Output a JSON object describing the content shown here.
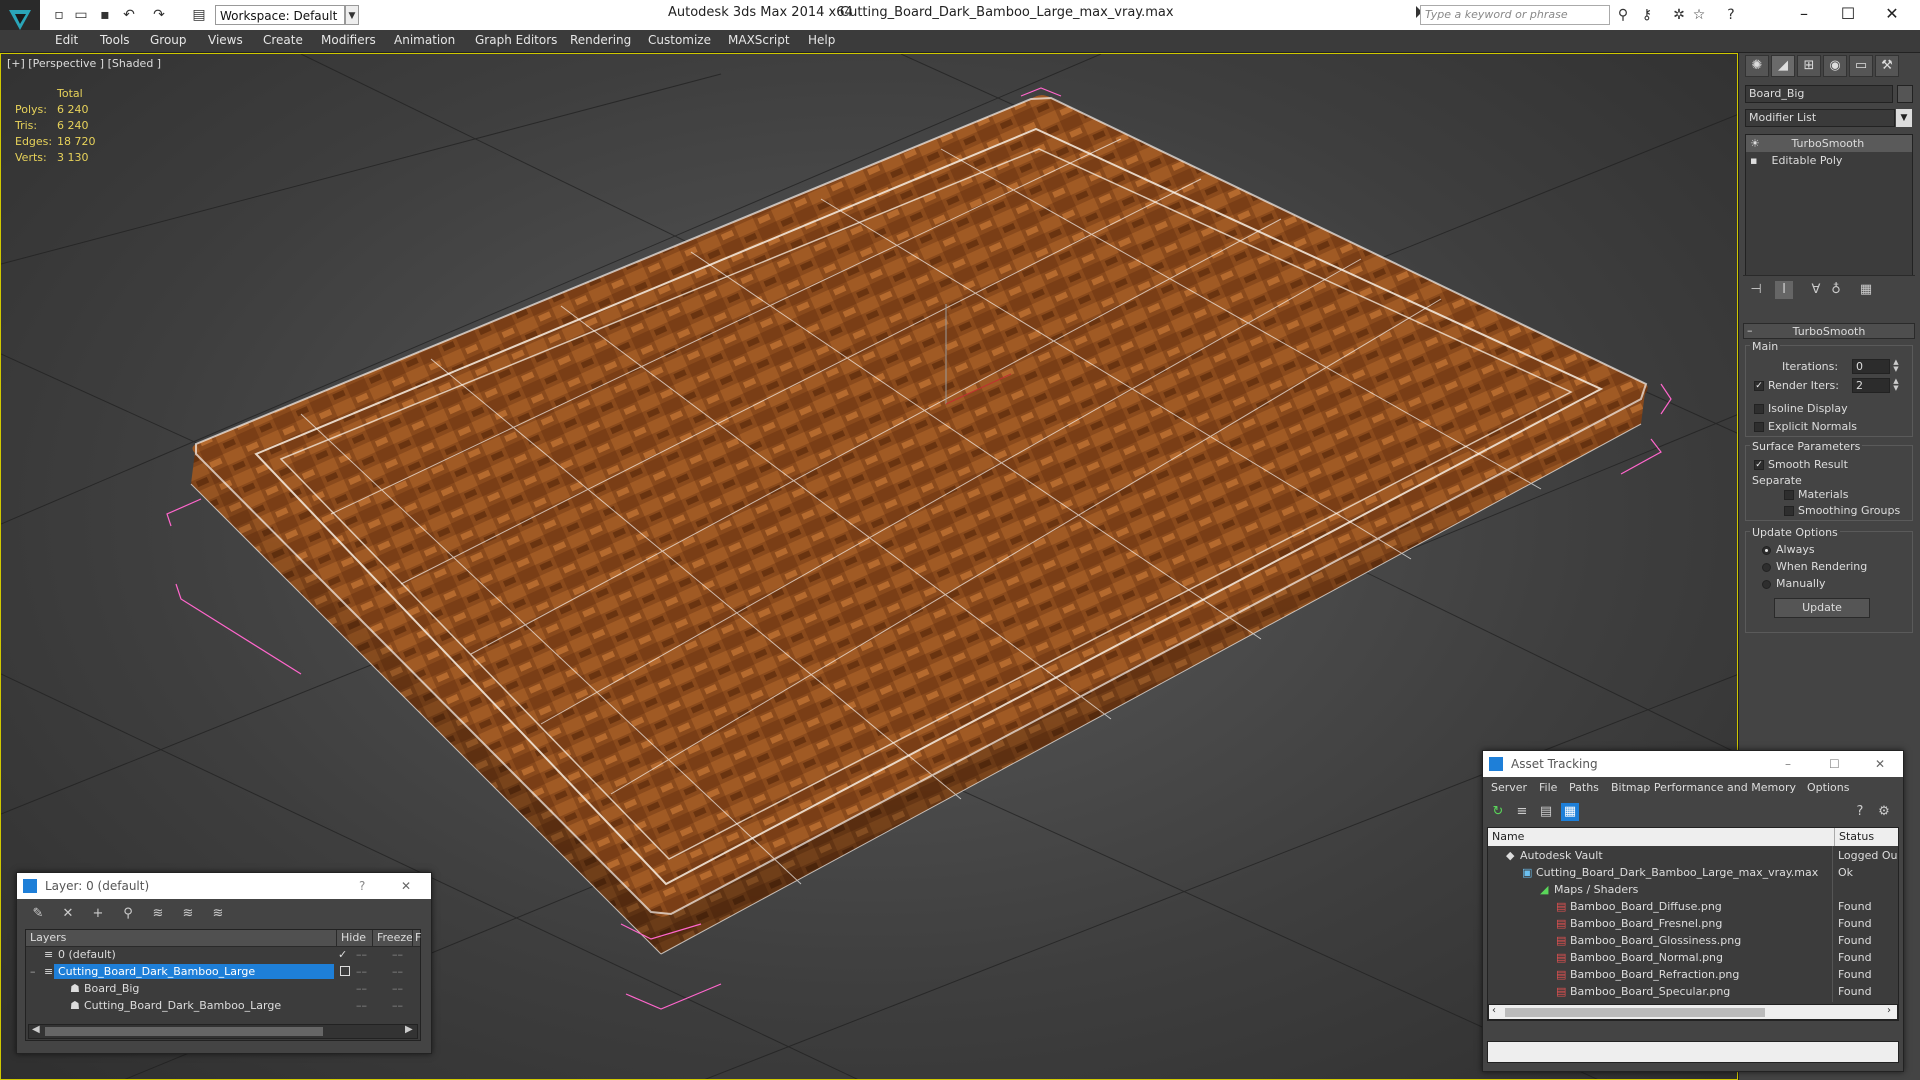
{
  "titlebar": {
    "app_title": "Autodesk 3ds Max  2014 x64",
    "file_title": "Cutting_Board_Dark_Bamboo_Large_max_vray.max",
    "workspace": "Workspace: Default",
    "search_placeholder": "Type a keyword or phrase"
  },
  "menu": [
    "Edit",
    "Tools",
    "Group",
    "Views",
    "Create",
    "Modifiers",
    "Animation",
    "Graph Editors",
    "Rendering",
    "Customize",
    "MAXScript",
    "Help"
  ],
  "viewport": {
    "label": "[+] [Perspective ] [Shaded ]",
    "stats": {
      "header": "Total",
      "rows": [
        {
          "k": "Polys:",
          "v": "6 240"
        },
        {
          "k": "Tris:",
          "v": "6 240"
        },
        {
          "k": "Edges:",
          "v": "18 720"
        },
        {
          "k": "Verts:",
          "v": "3 130"
        }
      ]
    }
  },
  "command_panel": {
    "object_name": "Board_Big",
    "modifier_list": "Modifier List",
    "stack": [
      "TurboSmooth",
      "Editable Poly"
    ],
    "rollout": "TurboSmooth",
    "main_group": "Main",
    "iterations_label": "Iterations:",
    "iterations_value": "0",
    "render_iters_label": "Render Iters:",
    "render_iters_value": "2",
    "isoline": "Isoline Display",
    "explicit_normals": "Explicit Normals",
    "surface_group": "Surface Parameters",
    "smooth_result": "Smooth Result",
    "separate": "Separate",
    "materials": "Materials",
    "smoothing_groups": "Smoothing Groups",
    "update_group": "Update Options",
    "always": "Always",
    "when_rendering": "When Rendering",
    "manually": "Manually",
    "update_btn": "Update"
  },
  "layer_window": {
    "title": "Layer: 0 (default)",
    "help": "?",
    "columns": [
      "Layers",
      "Hide",
      "Freeze",
      "F"
    ],
    "rows": [
      {
        "name": "0 (default)"
      },
      {
        "name": "Cutting_Board_Dark_Bamboo_Large"
      },
      {
        "name": "Board_Big"
      },
      {
        "name": "Cutting_Board_Dark_Bamboo_Large"
      }
    ]
  },
  "asset_window": {
    "title": "Asset Tracking",
    "menu": [
      "Server",
      "File",
      "Paths",
      "Bitmap Performance and Memory",
      "Options"
    ],
    "columns": [
      "Name",
      "Status"
    ],
    "rows": [
      {
        "name": "Autodesk Vault",
        "status": "Logged Ou"
      },
      {
        "name": "Cutting_Board_Dark_Bamboo_Large_max_vray.max",
        "status": "Ok"
      },
      {
        "name": "Maps / Shaders",
        "status": ""
      },
      {
        "name": "Bamboo_Board_Diffuse.png",
        "status": "Found"
      },
      {
        "name": "Bamboo_Board_Fresnel.png",
        "status": "Found"
      },
      {
        "name": "Bamboo_Board_Glossiness.png",
        "status": "Found"
      },
      {
        "name": "Bamboo_Board_Normal.png",
        "status": "Found"
      },
      {
        "name": "Bamboo_Board_Refraction.png",
        "status": "Found"
      },
      {
        "name": "Bamboo_Board_Specular.png",
        "status": "Found"
      }
    ]
  },
  "colors": {
    "wood": "#8a4a1c",
    "wire": "#ffffff",
    "selection": "#ff66cc",
    "accent": "#1e7fd8"
  }
}
